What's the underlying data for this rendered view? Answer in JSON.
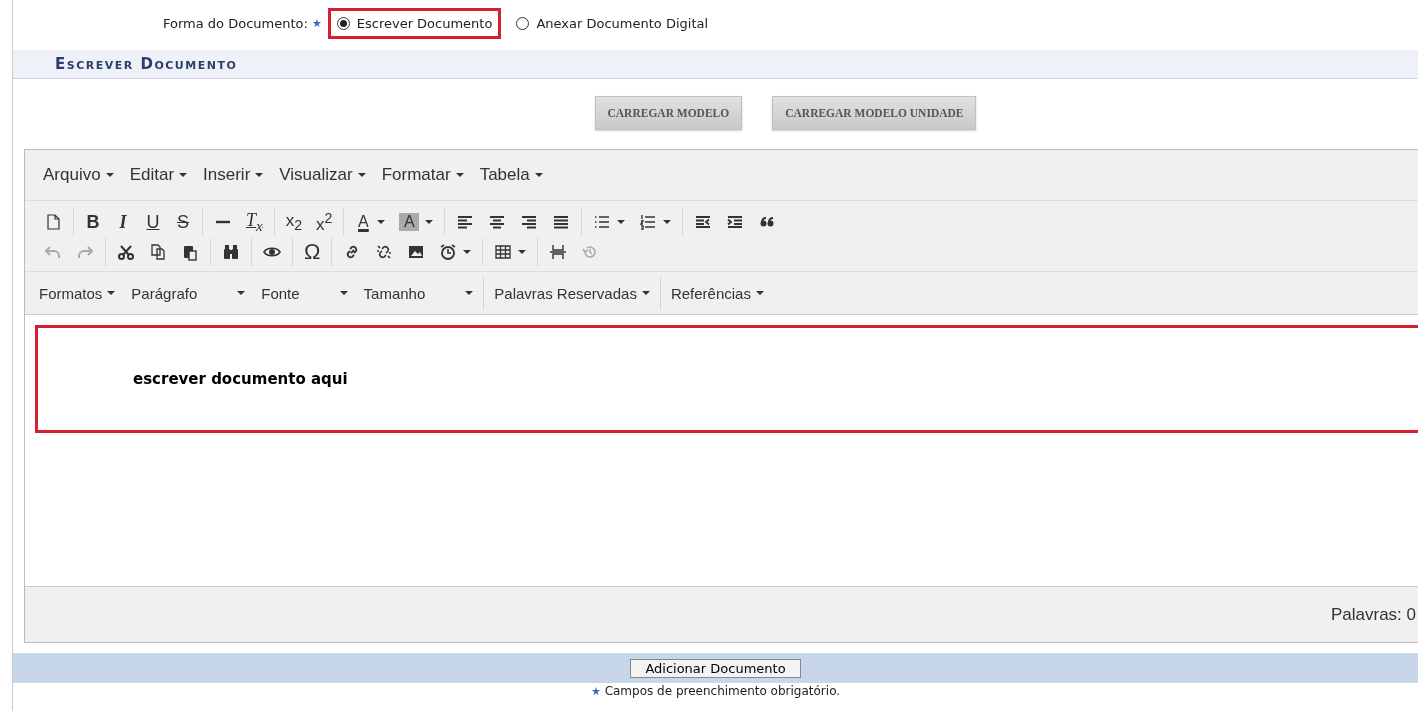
{
  "form_field": {
    "label": "Forma do Documento:",
    "required_mark": "★",
    "options": [
      {
        "label": "Escrever Documento",
        "selected": true,
        "highlighted": true
      },
      {
        "label": "Anexar Documento Digital",
        "selected": false,
        "highlighted": false
      }
    ]
  },
  "section_title": "Escrever Documento",
  "buttons": [
    "CARREGAR MODELO",
    "CARREGAR MODELO UNIDADE"
  ],
  "editor": {
    "menu": [
      "Arquivo",
      "Editar",
      "Inserir",
      "Visualizar",
      "Formatar",
      "Tabela"
    ],
    "toolbar_rows": [
      [
        [
          {
            "kind": "document",
            "caret": false,
            "disabled": false
          }
        ],
        [
          {
            "kind": "bold",
            "text": "B",
            "caret": false,
            "disabled": false
          },
          {
            "kind": "italic",
            "text": "I",
            "caret": false,
            "disabled": false
          },
          {
            "kind": "underline",
            "text": "U",
            "caret": false,
            "disabled": false
          },
          {
            "kind": "strike",
            "text": "S",
            "caret": false,
            "disabled": false
          }
        ],
        [
          {
            "kind": "rule",
            "caret": false,
            "disabled": false
          },
          {
            "kind": "clearformat",
            "text": "T$_{x}$",
            "caret": false,
            "disabled": false
          }
        ],
        [
          {
            "kind": "subscript",
            "text": "x$_{2}$",
            "caret": false,
            "disabled": false
          },
          {
            "kind": "superscript",
            "text": "x$^{2}$",
            "caret": false,
            "disabled": false
          }
        ],
        [
          {
            "kind": "textcolor",
            "text": "A",
            "caret": true,
            "disabled": false
          },
          {
            "kind": "backcolor",
            "text": "A",
            "caret": true,
            "disabled": false
          }
        ],
        [
          {
            "kind": "alignleft",
            "caret": false,
            "disabled": false
          },
          {
            "kind": "aligncenter",
            "caret": false,
            "disabled": false
          },
          {
            "kind": "alignright",
            "caret": false,
            "disabled": false
          },
          {
            "kind": "justify",
            "caret": false,
            "disabled": false
          }
        ],
        [
          {
            "kind": "bullets",
            "caret": true,
            "disabled": false
          },
          {
            "kind": "numbering",
            "caret": true,
            "disabled": false
          }
        ],
        [
          {
            "kind": "outdent",
            "caret": false,
            "disabled": false
          },
          {
            "kind": "indent",
            "caret": false,
            "disabled": false
          },
          {
            "kind": "blockquote",
            "caret": false,
            "disabled": false
          }
        ]
      ],
      [
        [
          {
            "kind": "undo",
            "caret": false,
            "disabled": true
          },
          {
            "kind": "redo",
            "caret": false,
            "disabled": true
          }
        ],
        [
          {
            "kind": "cut",
            "caret": false,
            "disabled": false
          },
          {
            "kind": "copy",
            "caret": false,
            "disabled": false
          },
          {
            "kind": "paste",
            "caret": false,
            "disabled": false
          }
        ],
        [
          {
            "kind": "find",
            "caret": false,
            "disabled": false
          }
        ],
        [
          {
            "kind": "preview",
            "caret": false,
            "disabled": false
          }
        ],
        [
          {
            "kind": "symbol",
            "text": "Ω",
            "caret": false,
            "disabled": false
          }
        ],
        [
          {
            "kind": "link",
            "caret": false,
            "disabled": false
          },
          {
            "kind": "unlink",
            "caret": false,
            "disabled": false
          },
          {
            "kind": "image",
            "caret": false,
            "disabled": false
          },
          {
            "kind": "clock",
            "caret": true,
            "disabled": false
          }
        ],
        [
          {
            "kind": "table",
            "caret": true,
            "disabled": false
          }
        ],
        [
          {
            "kind": "pagebreak",
            "caret": false,
            "disabled": false
          },
          {
            "kind": "history",
            "caret": false,
            "disabled": true
          }
        ]
      ]
    ],
    "format_bar": [
      [
        {
          "label": "Formatos",
          "kind": "menu"
        },
        {
          "label": "Parágrafo",
          "kind": "select"
        },
        {
          "label": "Fonte",
          "kind": "select"
        },
        {
          "label": "Tamanho",
          "kind": "select"
        }
      ],
      [
        {
          "label": "Palavras Reservadas",
          "kind": "menu"
        }
      ],
      [
        {
          "label": "Referências",
          "kind": "menu"
        }
      ]
    ],
    "content": {
      "text": "escrever documento aqui",
      "highlighted": true
    },
    "status": "Palavras: 0"
  },
  "submit_button": "Adicionar Documento",
  "footnote": {
    "mark": "★",
    "text": "Campos de preenchimento obrigatório."
  }
}
